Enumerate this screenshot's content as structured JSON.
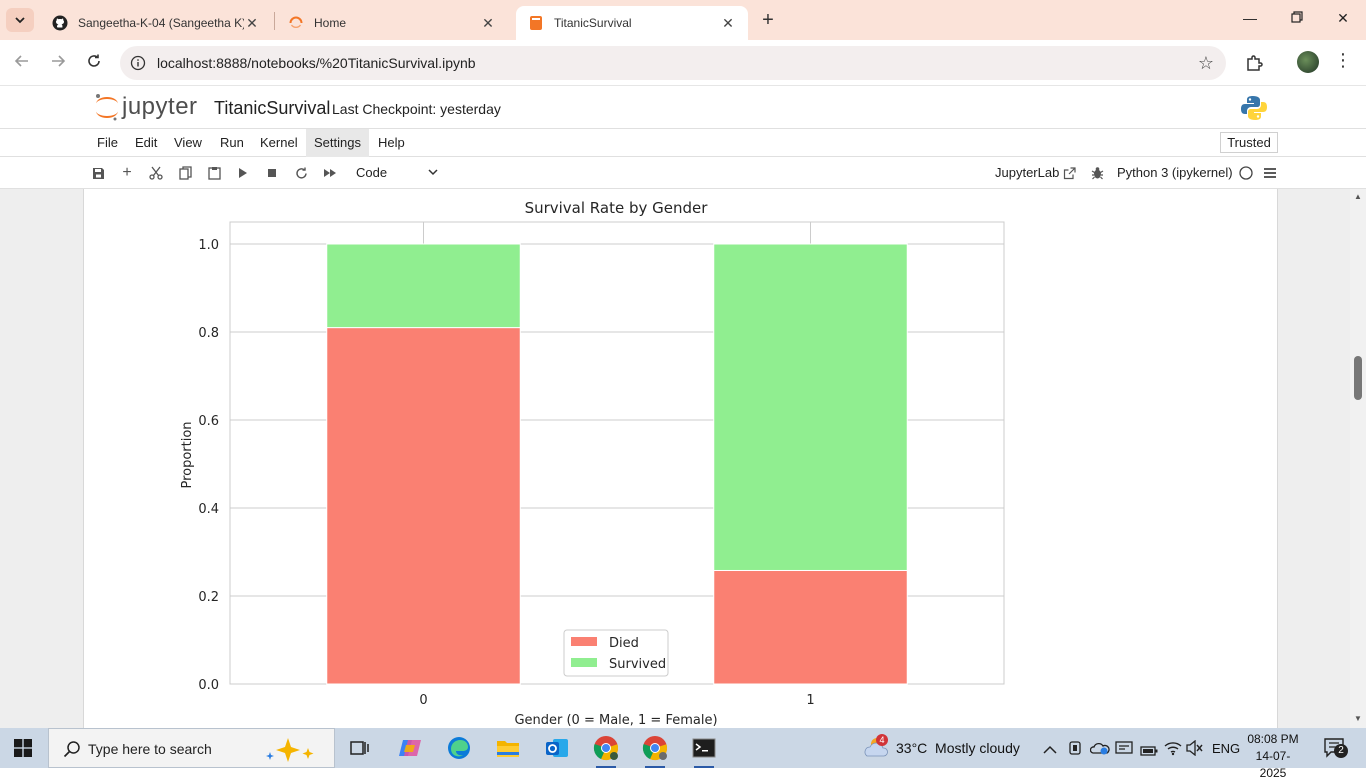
{
  "browser": {
    "tabs": [
      {
        "title": "Sangeetha-K-04 (Sangeetha K)",
        "icon": "github-icon"
      },
      {
        "title": "Home",
        "icon": "jupyter-spinner-icon"
      },
      {
        "title": "TitanicSurvival",
        "icon": "notebook-icon"
      }
    ],
    "url": "localhost:8888/notebooks/%20TitanicSurvival.ipynb"
  },
  "jupyter": {
    "logo_text": "jupyter",
    "notebook_title": "TitanicSurvival",
    "checkpoint": "Last Checkpoint: yesterday",
    "menu": [
      "File",
      "Edit",
      "View",
      "Run",
      "Kernel",
      "Settings",
      "Help"
    ],
    "trusted": "Trusted",
    "cell_type": "Code",
    "jupyterlab_link": "JupyterLab",
    "kernel": "Python 3 (ipykernel)"
  },
  "chart_data": {
    "type": "bar",
    "stacked": true,
    "title": "Survival Rate by Gender",
    "xlabel": "Gender (0 = Male, 1 = Female)",
    "ylabel": "Proportion",
    "categories": [
      "0",
      "1"
    ],
    "series": [
      {
        "name": "Died",
        "values": [
          0.81,
          0.258
        ],
        "color": "#fa8072"
      },
      {
        "name": "Survived",
        "values": [
          0.19,
          0.742
        ],
        "color": "#90ee90"
      }
    ],
    "ylim": [
      0,
      1.05
    ],
    "yticks": [
      "0.0",
      "0.2",
      "0.4",
      "0.6",
      "0.8",
      "1.0"
    ],
    "grid": true,
    "legend_position": "bottom-center"
  },
  "taskbar": {
    "search_placeholder": "Type here to search",
    "weather": "33°C  Mostly cloudy",
    "language": "ENG",
    "time": "08:08 PM",
    "date": "14-07-2025",
    "notification_count": "2",
    "weather_badge": "4"
  }
}
